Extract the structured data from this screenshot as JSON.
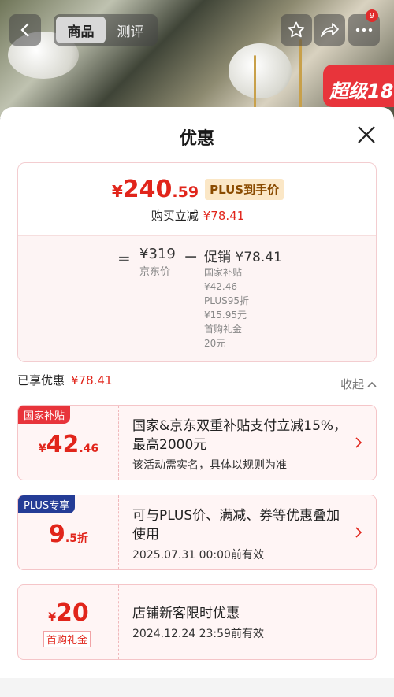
{
  "nav": {
    "tabs": [
      "商品",
      "测评"
    ],
    "active_tab": 0,
    "badge_count": "9"
  },
  "promo_banner": "超级18",
  "sheet": {
    "title": "优惠",
    "price_summary": {
      "yen": "¥",
      "final_int": "240",
      "final_dec": ".59",
      "plus_label": "PLUS到手价",
      "reduce_label": "购买立减",
      "reduce_amount": "¥78.41",
      "equals": "=",
      "jd_price": "¥319",
      "jd_label": "京东价",
      "minus": "−",
      "promo_head": "促销 ¥78.41",
      "promo_lines": [
        "国家补贴",
        "¥42.46",
        "PLUS95折",
        "¥15.95元",
        "首购礼金",
        "20元"
      ]
    },
    "enjoyed_label": "已享优惠",
    "enjoyed_amount": "¥78.41",
    "collapse_label": "收起",
    "coupons": [
      {
        "tag": "国家补贴",
        "yen": "¥",
        "amount_int": "42",
        "amount_dec": ".46",
        "title": "国家&京东双重补贴支付立减15%，最高2000元",
        "note": "该活动需实名，具体以规则为准"
      },
      {
        "tag": "PLUS专享",
        "amount_int": "9",
        "amount_dec": ".5折",
        "title": "可与PLUS价、满减、券等优惠叠加使用",
        "note": "2025.07.31 00:00前有效"
      },
      {
        "yen": "¥",
        "amount_int": "20",
        "sub_tag": "首购礼金",
        "title": "店铺新客限时优惠",
        "note": "2024.12.24 23:59前有效"
      }
    ]
  },
  "colors": {
    "accent_red": "#e1251b",
    "plus_blue": "#243c96",
    "plus_gold_bg": "#fbe7c6"
  },
  "icons": [
    "back-icon",
    "star-icon",
    "share-icon",
    "more-icon",
    "close-icon",
    "chevron-up-icon",
    "chevron-right-icon"
  ]
}
